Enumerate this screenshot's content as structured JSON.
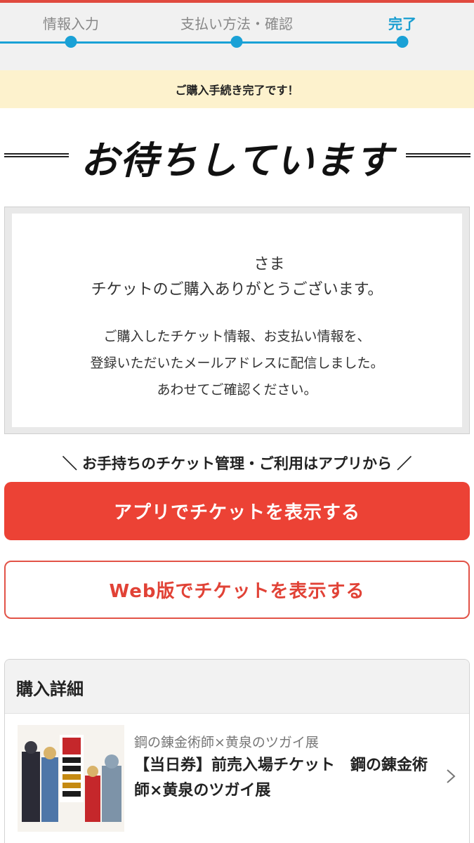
{
  "stepper": {
    "steps": [
      {
        "label": "情報入力"
      },
      {
        "label": "支払い方法・確認"
      },
      {
        "label": "完了"
      }
    ]
  },
  "notice": "ご購入手続き完了です！",
  "headline": "お待ちしています",
  "thanks": {
    "sama": "さま",
    "main": "チケットのご購入ありがとうございます。",
    "lines": [
      "ご購入したチケット情報、お支払い情報を、",
      "登録いただいたメールアドレスに配信しました。",
      "あわせてご確認ください。"
    ]
  },
  "app_prompt": "＼ お手持ちのチケット管理・ご利用はアプリから ／",
  "buttons": {
    "app": "アプリでチケットを表示する",
    "web": "Web版でチケットを表示する"
  },
  "detail": {
    "title": "購入詳細",
    "item": {
      "category": "鋼の錬金術師×黄泉のツガイ展",
      "title": "【当日券】前売入場チケット　鋼の錬金術師×黄泉のツガイ展",
      "thumbnail_icon": "event-poster-thumbnail"
    }
  },
  "colors": {
    "accent_blue": "#1aa1d6",
    "brand_red": "#ec4235",
    "notice_bg": "#fdf2cd"
  }
}
